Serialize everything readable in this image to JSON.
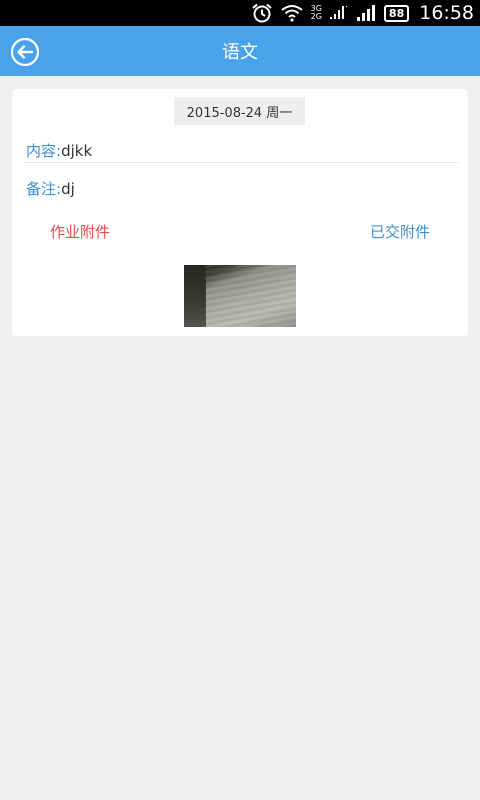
{
  "status_bar": {
    "network_top": "3G",
    "network_bottom": "2G",
    "battery": "88",
    "time": "16:58",
    "icons": [
      "alarm-icon",
      "wifi-icon",
      "signal-icon",
      "signal-icon",
      "battery-icon"
    ]
  },
  "app_bar": {
    "title": "语文",
    "back_icon": "back-arrow-icon",
    "color": "#4aa3ea"
  },
  "detail": {
    "date": "2015-08-24 周一",
    "content_label": "内容:",
    "content_value": "djkk",
    "note_label": "备注:",
    "note_value": "dj",
    "homework_attachment_label": "作业附件",
    "submitted_attachment_label": "已交附件"
  },
  "colors": {
    "label_blue": "#3d8fd0",
    "link_red": "#e84b4b",
    "background": "#efefef"
  }
}
